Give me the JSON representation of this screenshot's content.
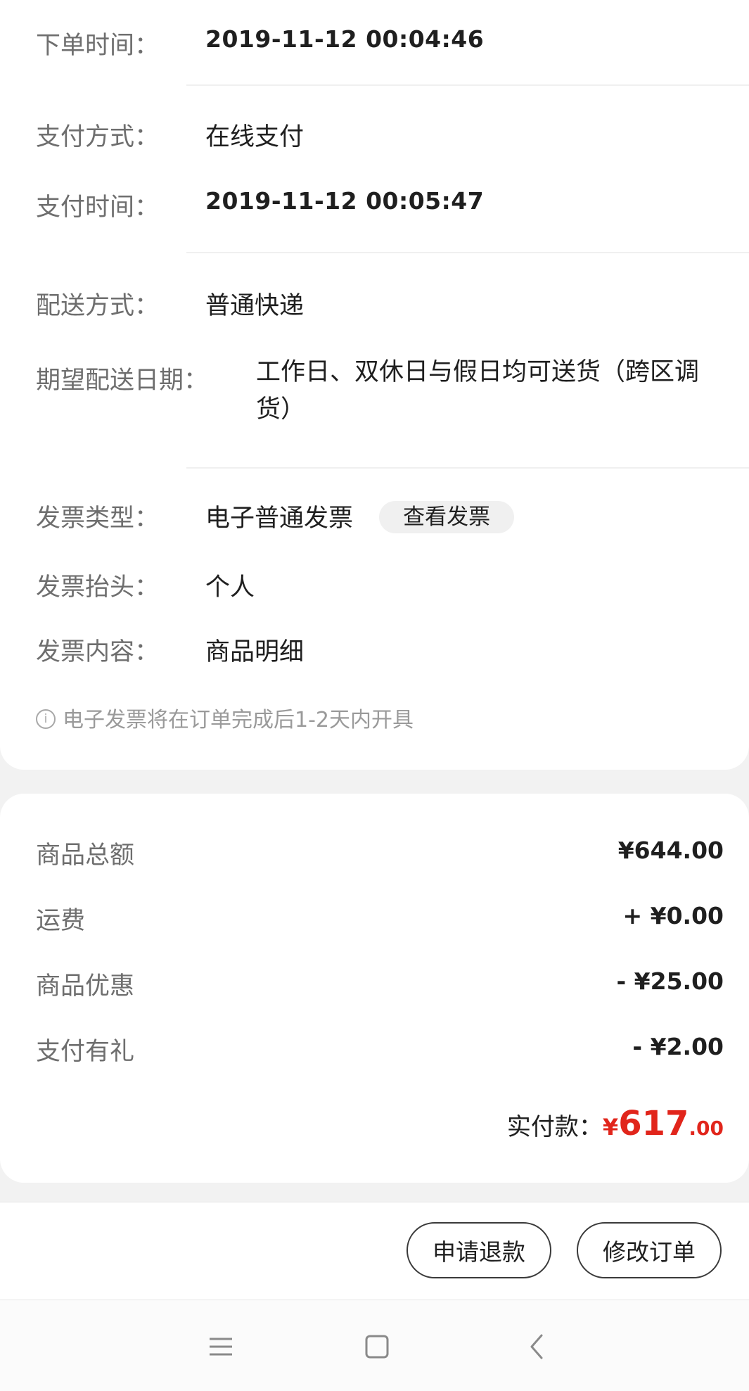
{
  "order_info": {
    "order_time": {
      "label": "下单时间：",
      "value": "2019-11-12 00:04:46"
    },
    "pay_method": {
      "label": "支付方式：",
      "value": "在线支付"
    },
    "pay_time": {
      "label": "支付时间：",
      "value": "2019-11-12 00:05:47"
    },
    "delivery_method": {
      "label": "配送方式：",
      "value": "普通快递"
    },
    "expected_delivery": {
      "label": "期望配送日期：",
      "value": "工作日、双休日与假日均可送货（跨区调货）"
    },
    "invoice_type": {
      "label": "发票类型：",
      "value": "电子普通发票",
      "button": "查看发票"
    },
    "invoice_title": {
      "label": "发票抬头：",
      "value": "个人"
    },
    "invoice_content": {
      "label": "发票内容：",
      "value": "商品明细"
    },
    "note": {
      "icon": "info-icon",
      "text": "电子发票将在订单完成后1-2天内开具"
    }
  },
  "price": {
    "goods_total": {
      "label": "商品总额",
      "value": "¥644.00"
    },
    "shipping": {
      "label": "运费",
      "value": "+ ¥0.00"
    },
    "discount": {
      "label": "商品优惠",
      "value": "- ¥25.00"
    },
    "pay_gift": {
      "label": "支付有礼",
      "value": "- ¥2.00"
    },
    "paid": {
      "label": "实付款：",
      "currency": "¥",
      "integer": "617",
      "decimal": ".00"
    }
  },
  "actions": {
    "refund": "申请退款",
    "modify": "修改订单"
  },
  "system_nav": [
    "menu-icon",
    "home-icon",
    "back-icon"
  ],
  "colors": {
    "accent": "#e1251b",
    "label": "#6e6e6e",
    "text": "#1f1f1f",
    "background": "#f2f2f2"
  }
}
